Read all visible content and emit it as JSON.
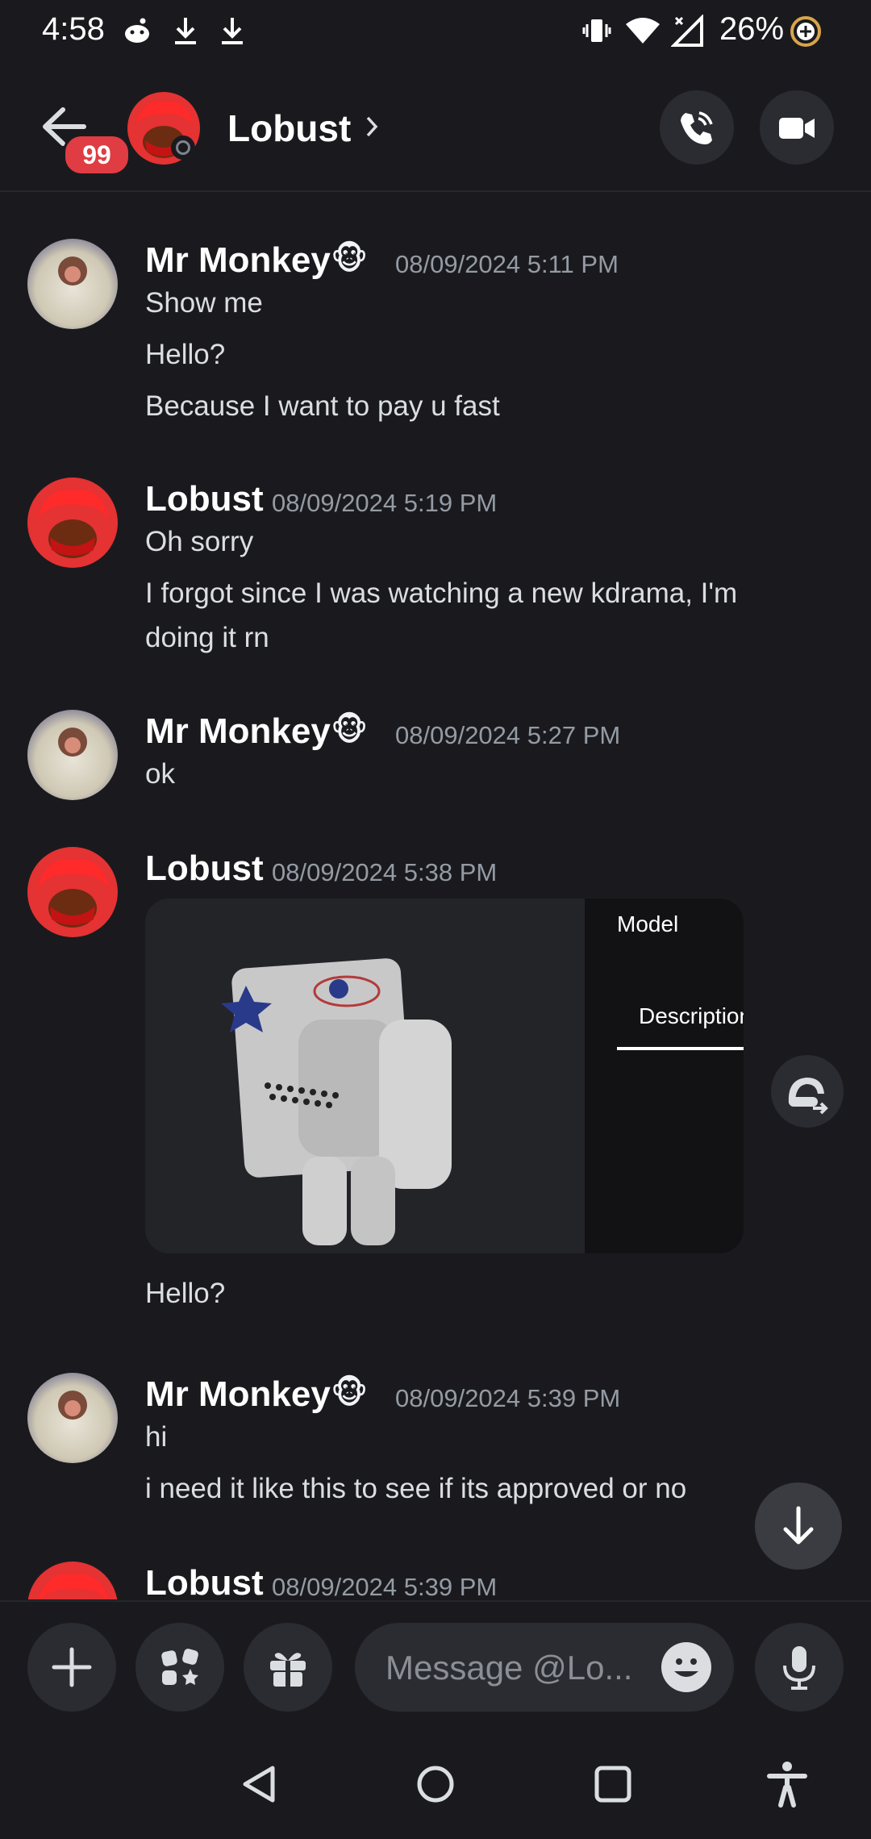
{
  "statusbar": {
    "time": "4:58",
    "battery": "26%"
  },
  "header": {
    "back_badge": "99",
    "contact_name": "Lobust"
  },
  "messages": [
    {
      "author": "Mr Monkey",
      "emoji": "🐵",
      "timestamp": "08/09/2024 5:11 PM",
      "lines": [
        "Show me",
        "Hello?",
        "Because I want to pay u fast"
      ]
    },
    {
      "author": "Lobust",
      "timestamp": "08/09/2024 5:19 PM",
      "lines": [
        "Oh sorry",
        "I forgot since I was watching a new kdrama, I'm",
        "doing it rn"
      ]
    },
    {
      "author": "Mr Monkey",
      "emoji": "🐵",
      "timestamp": "08/09/2024 5:27 PM",
      "lines": [
        "ok"
      ]
    },
    {
      "author": "Lobust",
      "timestamp": "08/09/2024 5:38 PM",
      "attachment": {
        "panel_title": "Model",
        "tab_label": "Description"
      },
      "lines": [
        "Hello?"
      ]
    },
    {
      "author": "Mr Monkey",
      "emoji": "🐵",
      "timestamp": "08/09/2024 5:39 PM",
      "lines": [
        "hi",
        "i need it like this to see if its approved or no"
      ]
    },
    {
      "author": "Lobust",
      "timestamp": "08/09/2024 5:39 PM",
      "lines": []
    }
  ],
  "composer": {
    "placeholder": "Message @Lo..."
  },
  "icons": {
    "header": [
      "back-arrow-icon",
      "voice-call-icon",
      "video-call-icon"
    ],
    "composer": [
      "plus-icon",
      "apps-icon",
      "gift-icon",
      "emoji-icon",
      "microphone-icon"
    ],
    "navbar": [
      "back-triangle-icon",
      "home-circle-icon",
      "recents-square-icon",
      "accessibility-icon"
    ]
  },
  "colors": {
    "background": "#1a1a1e",
    "badge": "#e03c43",
    "avatar_red": "#e53233",
    "timestamp": "#949ba4"
  }
}
